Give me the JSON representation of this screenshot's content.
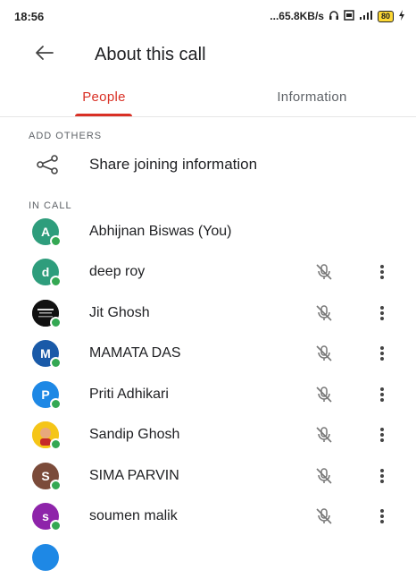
{
  "status_bar": {
    "time": "18:56",
    "network_speed": "...65.8KB/s",
    "battery": "80"
  },
  "header": {
    "title": "About this call"
  },
  "tabs": [
    {
      "label": "People",
      "active": true
    },
    {
      "label": "Information",
      "active": false
    }
  ],
  "add_others": {
    "section_label": "ADD OTHERS",
    "share_label": "Share joining information"
  },
  "in_call": {
    "section_label": "IN CALL",
    "participants": [
      {
        "initial": "A",
        "name": "Abhijnan Biswas (You)",
        "color": "#2e9d7c",
        "muted": false,
        "more": false
      },
      {
        "initial": "d",
        "name": "deep roy",
        "color": "#2e9d7c",
        "muted": true,
        "more": true
      },
      {
        "initial": "",
        "name": "Jit Ghosh",
        "color": "#111111",
        "muted": true,
        "more": true
      },
      {
        "initial": "M",
        "name": "MAMATA DAS",
        "color": "#1a5aa8",
        "muted": true,
        "more": true
      },
      {
        "initial": "P",
        "name": "Priti Adhikari",
        "color": "#1e88e5",
        "muted": true,
        "more": true
      },
      {
        "initial": "",
        "name": "Sandip Ghosh",
        "color": "#f5c518",
        "muted": true,
        "more": true
      },
      {
        "initial": "S",
        "name": "SIMA PARVIN",
        "color": "#7b4b3a",
        "muted": true,
        "more": true
      },
      {
        "initial": "s",
        "name": "soumen malik",
        "color": "#8e24aa",
        "muted": true,
        "more": true
      }
    ]
  }
}
